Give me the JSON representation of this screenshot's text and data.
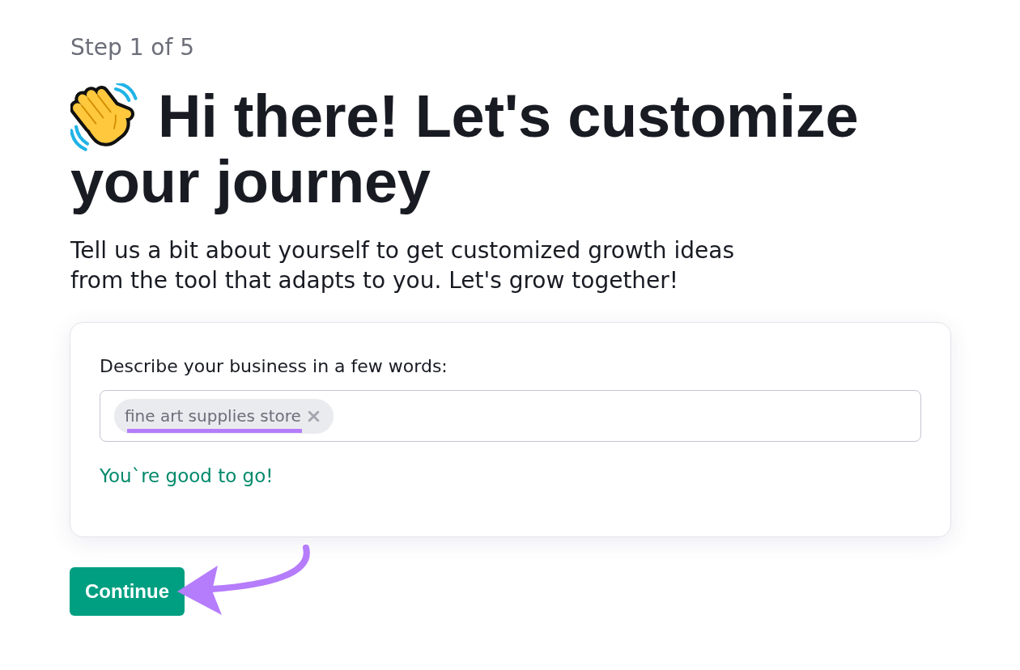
{
  "step": "Step 1 of 5",
  "heading": {
    "lines": [
      "Hi there! Let's customize",
      "your journey"
    ]
  },
  "intro": "Tell us a bit about yourself to get customized growth ideas from the tool that adapts to you. Let's grow together!",
  "form": {
    "label": "Describe your business in a few words:",
    "tags": [
      {
        "text": "fine art supplies store",
        "removable": true,
        "highlighted": true
      }
    ],
    "message": {
      "kind": "success",
      "text": "You`re good to go!"
    }
  },
  "primary_button": {
    "label": "Continue",
    "highlighted": true
  }
}
